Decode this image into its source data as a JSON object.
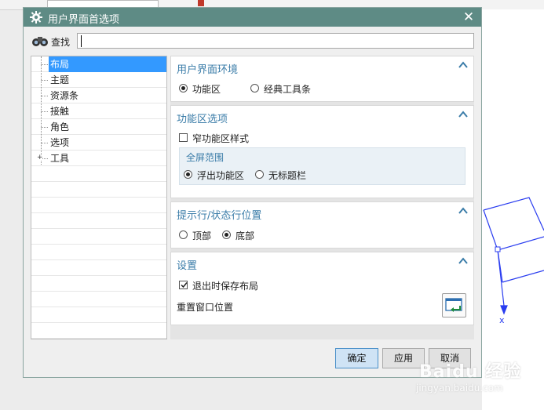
{
  "dialog": {
    "title": "用户界面首选项",
    "icon": "gear-icon",
    "close_icon": "close-icon"
  },
  "search": {
    "label": "查找",
    "icon": "binoculars-icon",
    "value": ""
  },
  "tree": {
    "items": [
      {
        "label": "布局",
        "selected": true
      },
      {
        "label": "主题"
      },
      {
        "label": "资源条"
      },
      {
        "label": "接触"
      },
      {
        "label": "角色"
      },
      {
        "label": "选项"
      },
      {
        "label": "工具",
        "expandable": true
      }
    ]
  },
  "sections": {
    "env": {
      "title": "用户界面环境",
      "options": [
        "功能区",
        "经典工具条"
      ],
      "selected": "功能区"
    },
    "ribbon": {
      "title": "功能区选项",
      "checkbox_label": "窄功能区样式",
      "checkbox_checked": false,
      "group_title": "全屏范围",
      "options": [
        "浮出功能区",
        "无标题栏"
      ],
      "selected": "浮出功能区"
    },
    "prompt": {
      "title": "提示行/状态行位置",
      "options": [
        "顶部",
        "底部"
      ],
      "selected": "底部"
    },
    "settings": {
      "title": "设置",
      "checkbox_label": "退出时保存布局",
      "checkbox_checked": true,
      "reset_label": "重置窗口位置",
      "reset_icon": "reset-window-icon"
    }
  },
  "buttons": {
    "ok": "确定",
    "apply": "应用",
    "cancel": "取消"
  },
  "watermark": {
    "brand": "Baidu 经验",
    "url": "jingyan.baidu.com"
  },
  "colors": {
    "titlebar": "#5e8b85",
    "section_title": "#3a7ca8",
    "selection": "#3399ff",
    "primary_button": "#cfe3f5"
  }
}
